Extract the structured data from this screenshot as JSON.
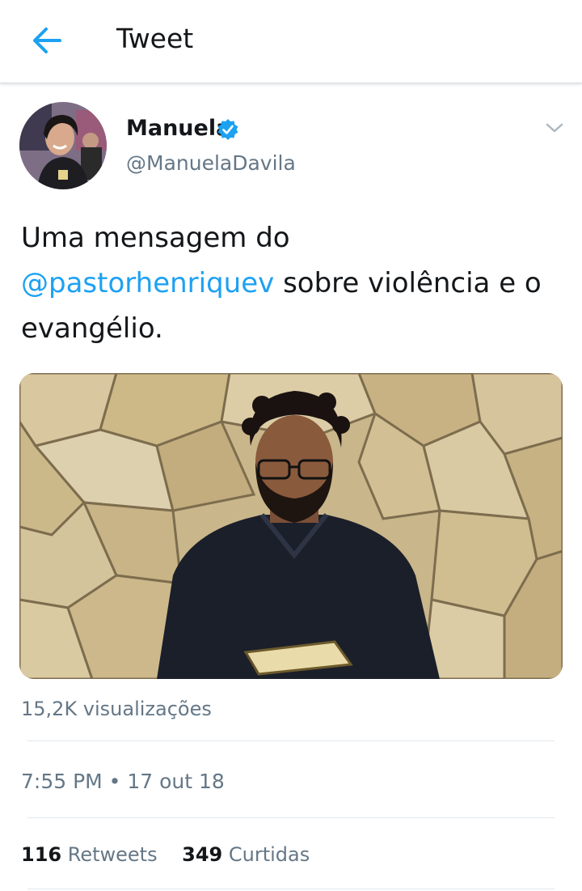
{
  "header": {
    "title": "Tweet",
    "back_icon": "arrow-left-icon"
  },
  "tweet": {
    "author": {
      "name": "Manuela",
      "handle": "@ManuelaDavila",
      "verified": true
    },
    "text_before": "Uma mensagem do ",
    "mention": "@pastorhenriquev",
    "text_after": " sobre violência e o evangélio.",
    "views": "15,2K visualizações",
    "time": "7:55 PM",
    "separator": " • ",
    "date": "17 out 18",
    "retweets_count": "116",
    "retweets_label": "Retweets",
    "likes_count": "349",
    "likes_label": "Curtidas"
  },
  "colors": {
    "accent": "#1da1f2",
    "secondary_text": "#657786",
    "primary_text": "#14171a",
    "divider": "#e1e8ed"
  }
}
